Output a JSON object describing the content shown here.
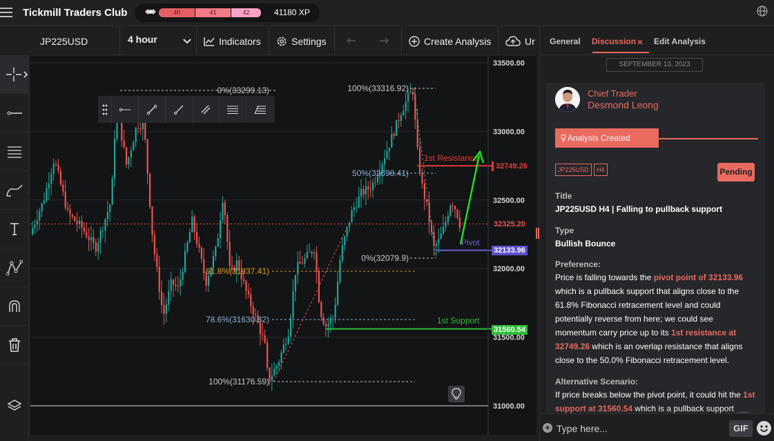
{
  "topbar": {
    "brand": "Tickmill Traders Club",
    "levels": [
      "40",
      "41",
      "42"
    ],
    "xp": "41180 XP"
  },
  "toolbar": {
    "symbol": "JP225USD",
    "timeframe": "4 hour",
    "indicators": "Indicators",
    "settings": "Settings",
    "create": "Create Analysis",
    "upload": "Ur"
  },
  "chart": {
    "price_labels": [
      "33500.00",
      "33000.00",
      "32500.00",
      "32000.00",
      "31500.00",
      "31000.00"
    ],
    "tags": {
      "resistance": "32749.26",
      "current": "32325.20",
      "pivot": "32133.96",
      "support": "31560.54"
    },
    "line_labels": {
      "resistance": "1st Resistance",
      "pivot": "Pivot",
      "support": "1st Support"
    },
    "fib_labels": [
      "0%(33299.13)",
      "100%(33316.92)",
      "50%(32698.41)",
      "0%(32079.9)",
      "61.8%(31937.41)",
      "78.6%(31630.82)",
      "100%(31176.59)"
    ],
    "colors": {
      "up": "#26a69a",
      "down": "#ef5350",
      "resistance": "#e23b3b",
      "support": "#2fbd3a",
      "pivot": "#6a5fd6",
      "arrow": "#22dd22"
    }
  },
  "panel": {
    "tabs": [
      "General",
      "Discussion",
      "Edit Analysis"
    ],
    "date": "SEPTEMBER 13, 2023",
    "author_role": "Chief Trader",
    "author_name": "Desmond Leong",
    "created": "Analysis Created",
    "tags": [
      "JP225USD",
      "H4"
    ],
    "status": "Pending",
    "title_label": "Title",
    "title": "JP225USD H4 | Falling to pullback support",
    "type_label": "Type",
    "type": "Bullish Bounce",
    "pref_label": "Preference:",
    "pref": {
      "t1": "Price is falling towards the ",
      "h1": "pivot point of 32133.96",
      "t2": " which is a pullback support that aligns close to the 61.8% Fibonacci retracement level and could potentially reverse from here; we could see momentum carry price up to its ",
      "h2": "1st resistance at 32749.26",
      "t3": " which is an overlap resistance that aligns close to the 50.0% Fibonacci retracement level."
    },
    "alt_label": "Alternative Scenario:",
    "alt": {
      "t1": "If price breaks below the pivot point, it could hit the ",
      "h1": "1st support at 31560.54",
      "t2": " which is a pullback support"
    },
    "input_placeholder": "Type here...",
    "gif": "GIF"
  }
}
